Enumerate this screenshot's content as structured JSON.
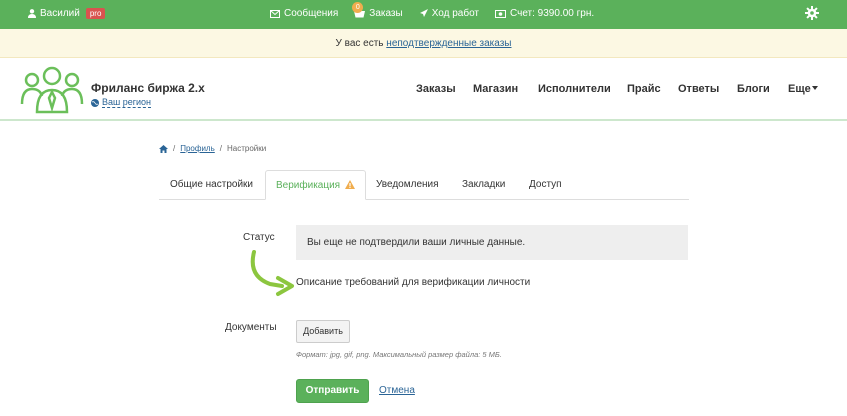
{
  "topbar": {
    "user_name": "Василий",
    "pro_badge": "pro",
    "messages": "Сообщения",
    "orders": "Заказы",
    "orders_count": "0",
    "progress": "Ход работ",
    "balance": "Счет: 9390.00 грн."
  },
  "alert": {
    "text": "У вас есть ",
    "link": "неподтвержденные заказы"
  },
  "header": {
    "brand": "Фриланс биржа 2.х",
    "region": "Ваш регион",
    "nav": [
      "Заказы",
      "Магазин",
      "Исполнители",
      "Прайс",
      "Ответы",
      "Блоги",
      "Еще"
    ]
  },
  "breadcrumb": {
    "profile": "Профиль",
    "current": "Настройки",
    "sep": "/"
  },
  "tabs": [
    {
      "label": "Общие настройки",
      "active": false
    },
    {
      "label": "Верификация",
      "active": true
    },
    {
      "label": "Уведомления",
      "active": false
    },
    {
      "label": "Закладки",
      "active": false
    },
    {
      "label": "Доступ",
      "active": false
    }
  ],
  "form": {
    "status_label": "Статус",
    "status_text": "Вы еще не подтвердили ваши личные данные.",
    "requirements": "Описание требований для верификации личности",
    "documents_label": "Документы",
    "add_button": "Добавить",
    "hint": "Формат: jpg, gif, png. Максимальный размер файла: 5 МБ.",
    "submit": "Отправить",
    "cancel": "Отмена"
  },
  "colors": {
    "brand_green": "#5bb15b",
    "link_blue": "#2a6496",
    "alert_bg": "#fcf8e3",
    "warning": "#f0ad4e"
  }
}
